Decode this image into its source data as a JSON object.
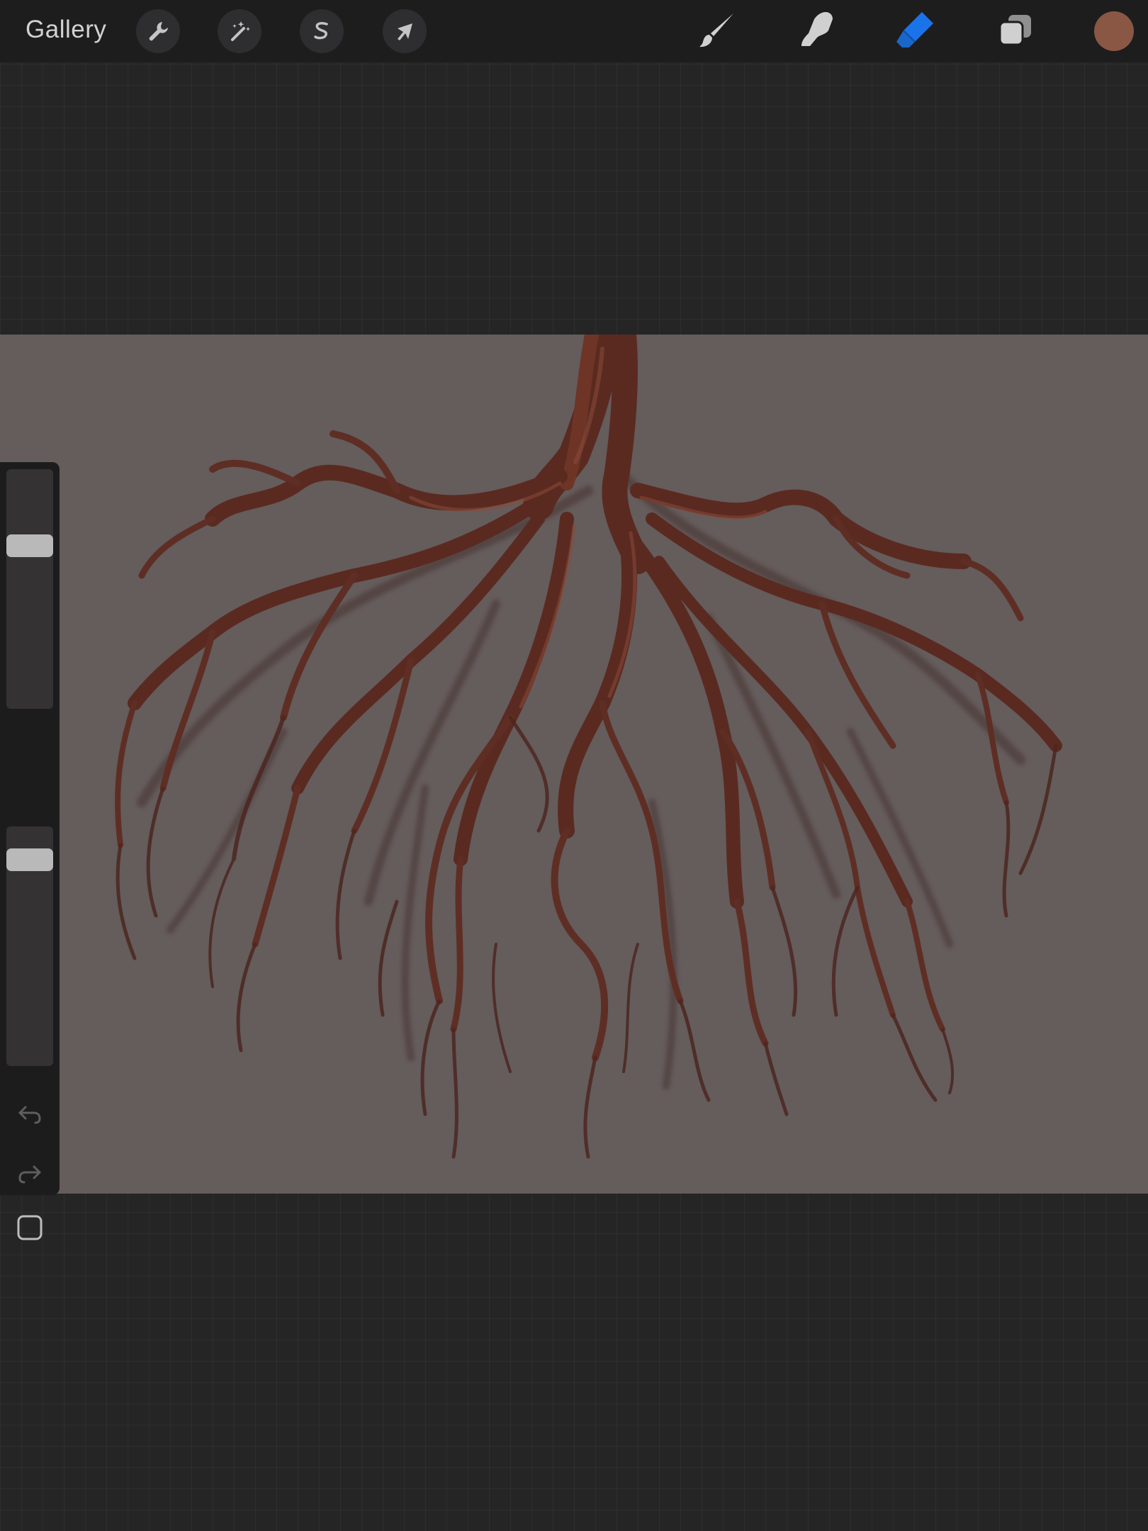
{
  "topbar": {
    "gallery_label": "Gallery",
    "left_tools": [
      {
        "name": "actions",
        "icon": "wrench-icon"
      },
      {
        "name": "adjustments",
        "icon": "magic-wand-icon"
      },
      {
        "name": "selection",
        "icon": "selection-s-icon"
      },
      {
        "name": "transform",
        "icon": "arrow-cursor-icon"
      }
    ],
    "right_tools": [
      {
        "name": "brush",
        "icon": "brush-icon",
        "active": false
      },
      {
        "name": "smudge",
        "icon": "smudge-finger-icon",
        "active": false
      },
      {
        "name": "eraser",
        "icon": "eraser-icon",
        "active": true
      },
      {
        "name": "layers",
        "icon": "layers-icon",
        "active": false
      }
    ],
    "current_color": "#8a5745"
  },
  "sidebar": {
    "brush_size_level": 0.7,
    "opacity_level": 0.9,
    "undo_icon": "undo-icon",
    "redo_icon": "redo-icon",
    "modify_icon": "square-icon"
  },
  "colors": {
    "accent": "#1a73e8",
    "canvas_background": "#655c5c",
    "root_color": "#5a2a20"
  }
}
